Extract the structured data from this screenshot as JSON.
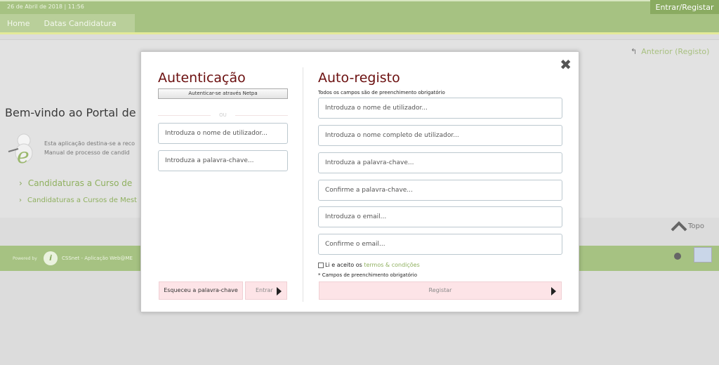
{
  "topbar": {
    "date": "26 de Abril de 2018 | 11:56",
    "login_label": "Entrar/Registar"
  },
  "nav": {
    "items": [
      {
        "label": "Home"
      },
      {
        "label": "Datas Candidatura"
      }
    ]
  },
  "page": {
    "back_link": "Anterior (Registo)",
    "welcome": "Bem-vindo ao Portal de",
    "desc_line1": "Esta aplicação destina-se a reco",
    "desc_line2": "Manual de processo de candid",
    "links": [
      {
        "label": "Candidaturas a Curso de"
      },
      {
        "label": "Candidaturas a Cursos de Mest"
      }
    ],
    "topo": "Topo"
  },
  "footer": {
    "powered": "Powered by",
    "logo_letter": "i",
    "text": "CSSnet - Aplicação Web@ME"
  },
  "modal": {
    "auth": {
      "title": "Autenticação",
      "netpa_button": "Autenticar-se através Netpa",
      "or_label": "OU",
      "username_placeholder": "Introduza o nome de utilizador...",
      "password_placeholder": "Introduza a palavra-chave...",
      "forgot_button": "Esqueceu a palavra-chave",
      "enter_button": "Entrar"
    },
    "register": {
      "title": "Auto-registo",
      "required_note": "Todos os campos são de preenchimento obrigatório",
      "fields": [
        "Introduza o nome de utilizador...",
        "Introduza o nome completo de utilizador...",
        "Introduza a palavra-chave...",
        "Confirme a palavra-chave...",
        "Introduza o email...",
        "Confirme o email..."
      ],
      "terms_prefix": "Li e aceito os ",
      "terms_link": "termos & condições",
      "required_footer": "* Campos de preenchimento obrigatório",
      "register_button": "Registar"
    },
    "close_symbol": "✖"
  }
}
